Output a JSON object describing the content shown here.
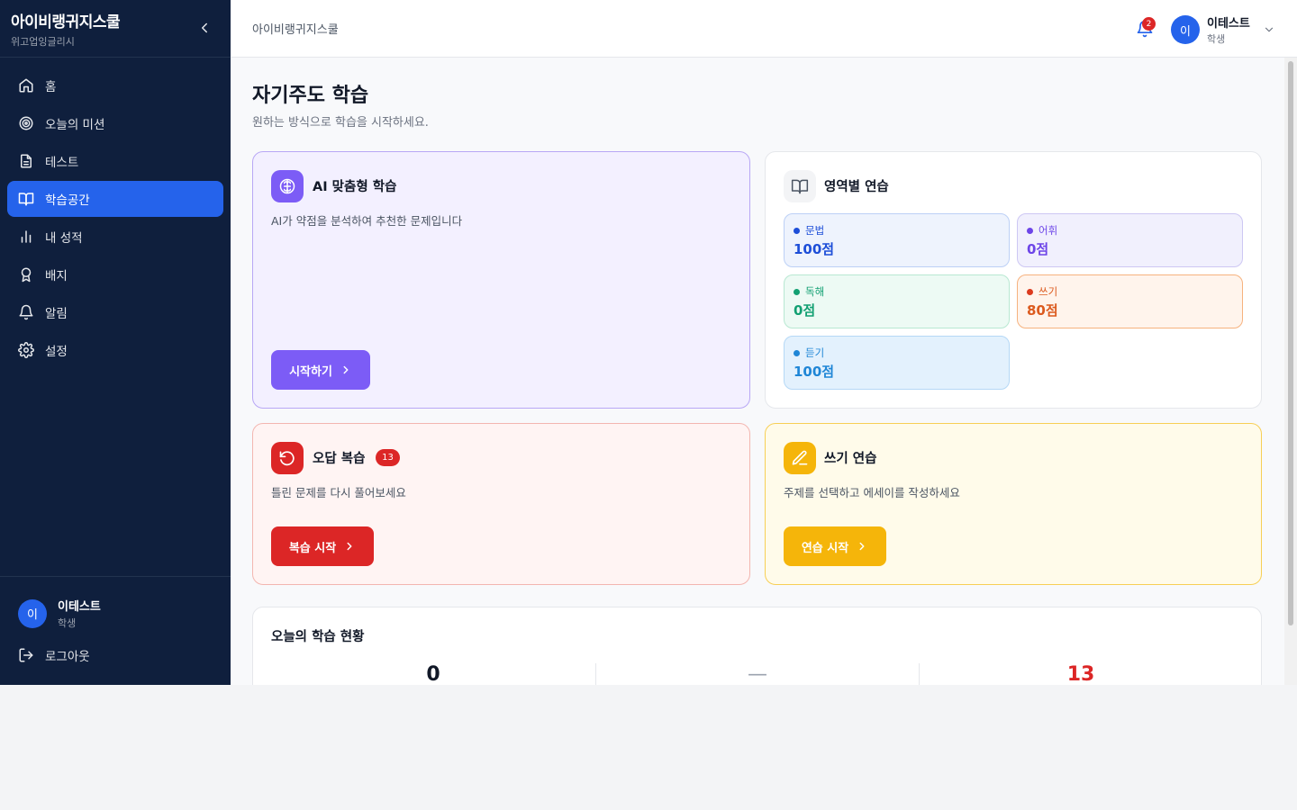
{
  "app": {
    "title": "아이비랭귀지스쿨",
    "subtitle": "위고업잉글리시"
  },
  "sidebar": {
    "items": [
      {
        "label": "홈",
        "icon": "home-icon"
      },
      {
        "label": "오늘의 미션",
        "icon": "target-icon"
      },
      {
        "label": "테스트",
        "icon": "document-icon"
      },
      {
        "label": "학습공간",
        "icon": "book-open-icon",
        "active": true
      },
      {
        "label": "내 성적",
        "icon": "bar-chart-icon"
      },
      {
        "label": "배지",
        "icon": "award-icon"
      },
      {
        "label": "알림",
        "icon": "bell-icon"
      },
      {
        "label": "설정",
        "icon": "gear-icon"
      }
    ],
    "user": {
      "avatar": "이",
      "name": "이테스트",
      "role": "학생"
    },
    "logout_label": "로그아웃"
  },
  "header": {
    "breadcrumb": "아이비랭귀지스쿨",
    "notification_count": "2",
    "user": {
      "avatar": "이",
      "name": "이테스트",
      "role": "학생"
    }
  },
  "main": {
    "title": "자기주도 학습",
    "subtitle": "원하는 방식으로 학습을 시작하세요.",
    "ai_card": {
      "title": "AI 맞춤형 학습",
      "desc": "AI가 약점을 분석하여 추천한 문제입니다",
      "button": "시작하기",
      "icon": "brain-icon"
    },
    "area_card": {
      "title": "영역별 연습",
      "icon": "book-open-icon",
      "skills": [
        {
          "label": "문법",
          "score": "100점"
        },
        {
          "label": "어휘",
          "score": "0점"
        },
        {
          "label": "독해",
          "score": "0점"
        },
        {
          "label": "쓰기",
          "score": "80점"
        },
        {
          "label": "듣기",
          "score": "100점"
        }
      ]
    },
    "wrong_card": {
      "title": "오답 복습",
      "badge": "13",
      "desc": "틀린 문제를 다시 풀어보세요",
      "button": "복습 시작",
      "icon": "rotate-ccw-icon"
    },
    "write_card": {
      "title": "쓰기 연습",
      "desc": "주제를 선택하고 에세이를 작성하세요",
      "button": "연습 시작",
      "icon": "pencil-icon"
    },
    "today": {
      "title": "오늘의 학습 현황",
      "stats": [
        "0",
        "—",
        "13"
      ]
    }
  },
  "colors": {
    "sidebar_bg": "#0f1f3d",
    "accent": "#2563eb",
    "ai_purple": "#7c5cf6",
    "wrong_red": "#dc2626",
    "write_amber": "#f5b50a"
  }
}
